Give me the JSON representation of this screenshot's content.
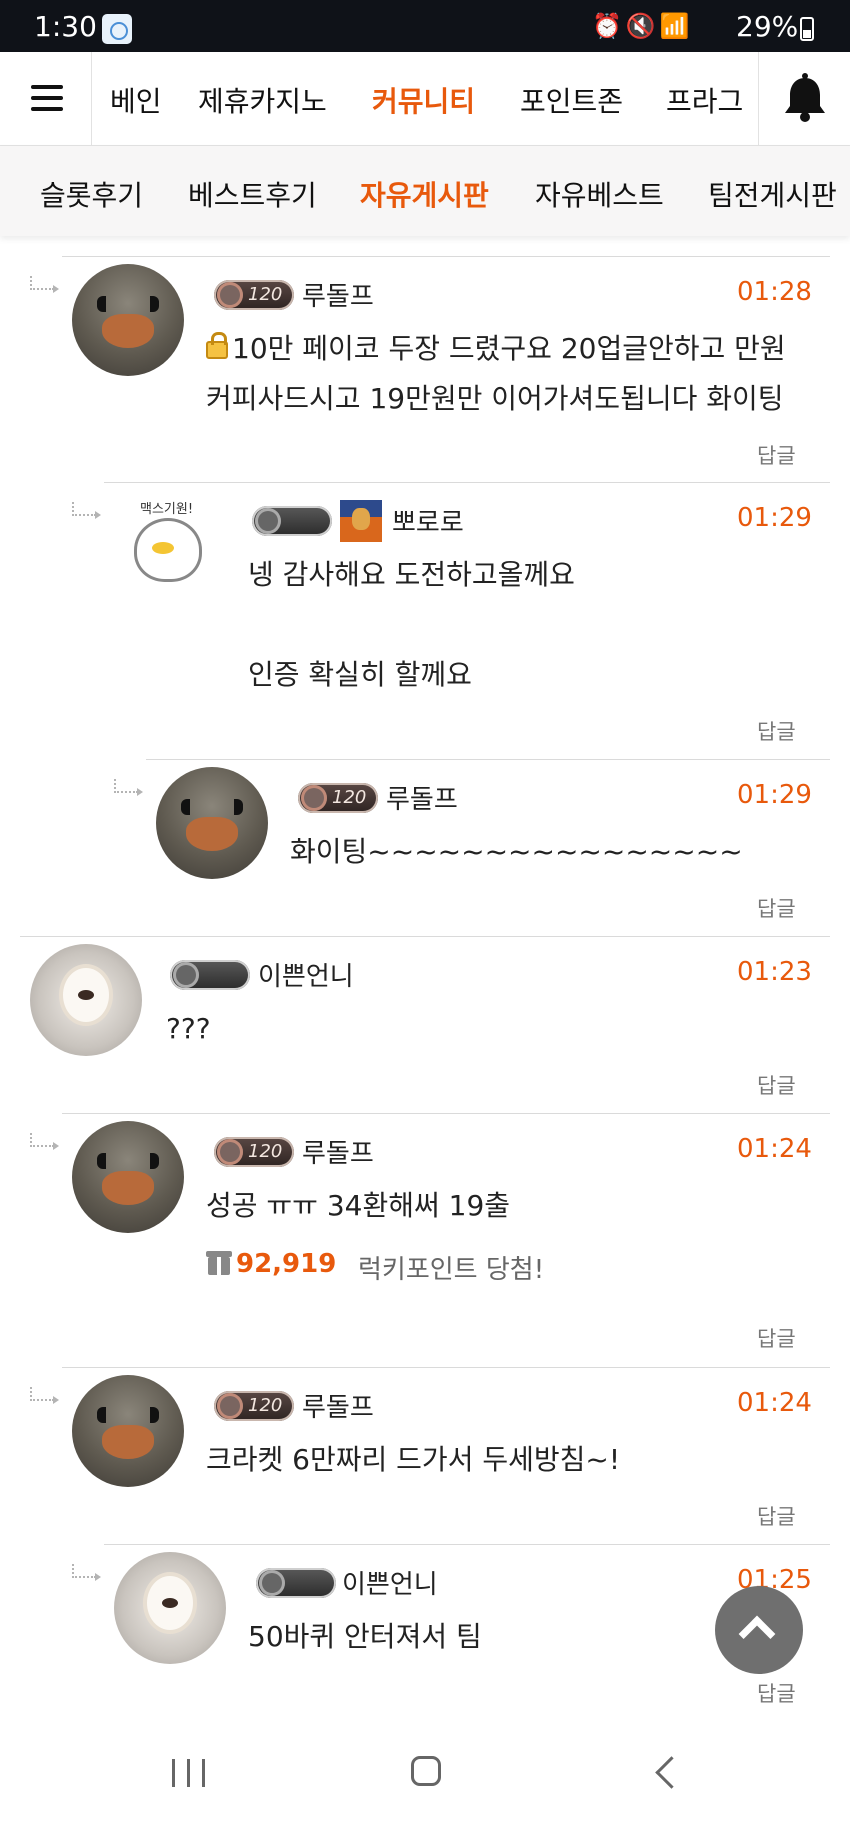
{
  "status_bar": {
    "time": "1:30",
    "icons": "⏰🔇📶",
    "battery": "29%"
  },
  "main_nav": {
    "items": [
      "베인",
      "제휴카지노",
      "커뮤니티",
      "포인트존",
      "프라그"
    ],
    "active_index": 2
  },
  "sub_nav": {
    "items": [
      "슬롯후기",
      "베스트후기",
      "자유게시판",
      "자유베스트",
      "팀전게시판"
    ],
    "active_index": 2
  },
  "reply_label": "답글",
  "comments": [
    {
      "nickname": "루돌프",
      "level_badge": "120",
      "time": "01:28",
      "lines": [
        "10만 페이코 두장 드렸구요 20업글안하고 만원",
        "커피사드시고 19만원만 이어가셔도됩니다 화이팅"
      ]
    },
    {
      "nickname": "뽀로로",
      "level_badge": "",
      "time": "01:29",
      "sticker_text": "맥스기원!",
      "lines": [
        "넹 감사해요 도전하고올께요",
        "",
        "인증 확실히 할께요"
      ]
    },
    {
      "nickname": "루돌프",
      "level_badge": "120",
      "time": "01:29",
      "lines": [
        "화이팅~~~~~~~~~~~~~~~~"
      ]
    },
    {
      "nickname": "이쁜언니",
      "level_badge": "",
      "time": "01:23",
      "lines": [
        "???"
      ]
    },
    {
      "nickname": "루돌프",
      "level_badge": "120",
      "time": "01:24",
      "lines": [
        "성공 ㅠㅠ 34환해써 19출"
      ],
      "lucky_points": "92,919",
      "lucky_label": "럭키포인트 당첨!"
    },
    {
      "nickname": "루돌프",
      "level_badge": "120",
      "time": "01:24",
      "lines": [
        "크라켓 6만짜리 드가서 두세방침~!"
      ]
    },
    {
      "nickname": "이쁜언니",
      "level_badge": "",
      "time": "01:25",
      "lines": [
        "50바퀴 안터져서 팀"
      ]
    }
  ]
}
